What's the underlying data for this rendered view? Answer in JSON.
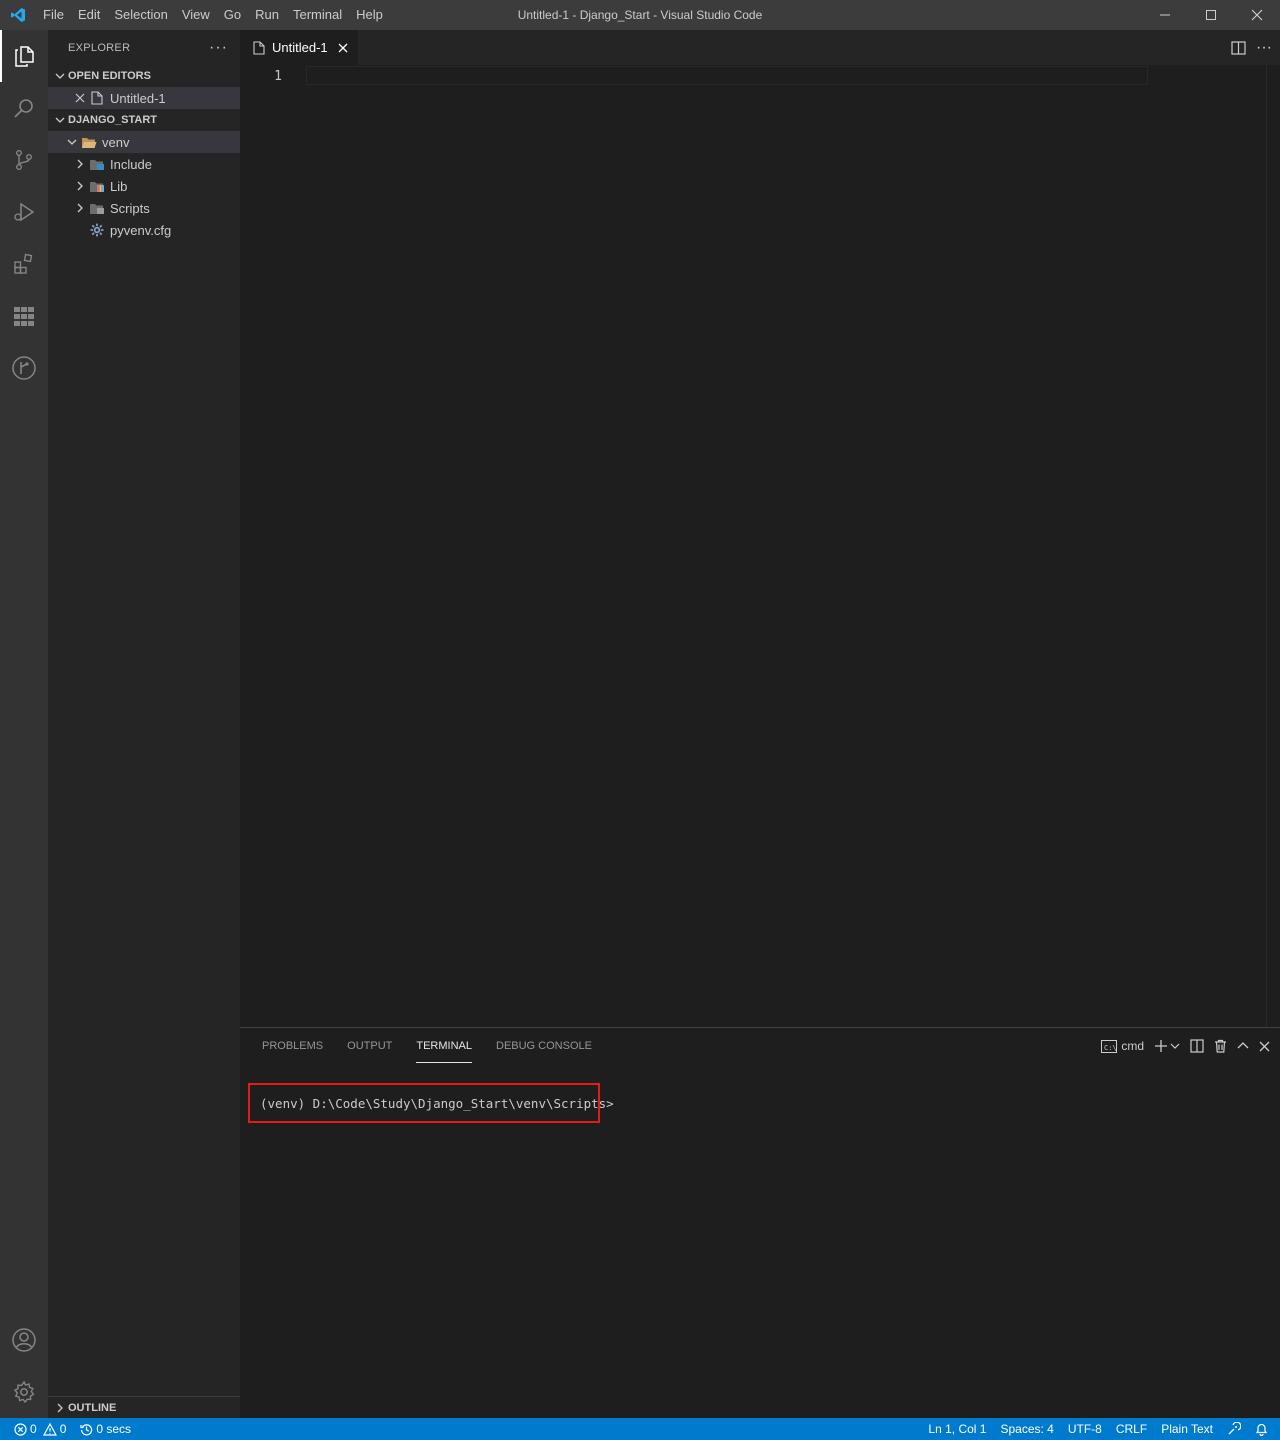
{
  "window": {
    "title": "Untitled-1 - Django_Start - Visual Studio Code"
  },
  "menu": [
    "File",
    "Edit",
    "Selection",
    "View",
    "Go",
    "Run",
    "Terminal",
    "Help"
  ],
  "sidebar": {
    "title": "EXPLORER",
    "open_editors": {
      "label": "OPEN EDITORS",
      "items": [
        {
          "name": "Untitled-1"
        }
      ]
    },
    "folder": {
      "label": "DJANGO_START",
      "items": [
        {
          "name": "venv"
        },
        {
          "name": "Include"
        },
        {
          "name": "Lib"
        },
        {
          "name": "Scripts"
        },
        {
          "name": "pyvenv.cfg"
        }
      ]
    },
    "outline_label": "OUTLINE"
  },
  "editor": {
    "tab_label": "Untitled-1",
    "line_number": "1"
  },
  "panel": {
    "tabs": [
      "PROBLEMS",
      "OUTPUT",
      "TERMINAL",
      "DEBUG CONSOLE"
    ],
    "active_tab": "TERMINAL",
    "shell_name": "cmd",
    "terminal_prompt": "(venv) D:\\Code\\Study\\Django_Start\\venv\\Scripts>"
  },
  "statusbar": {
    "errors": "0",
    "warnings": "0",
    "timer": "0 secs",
    "position": "Ln 1, Col 1",
    "indent": "Spaces: 4",
    "encoding": "UTF-8",
    "eol": "CRLF",
    "language": "Plain Text"
  },
  "colors": {
    "accent": "#007acc",
    "highlight_box": "#e51b1b",
    "folder": "#dcb67a"
  }
}
